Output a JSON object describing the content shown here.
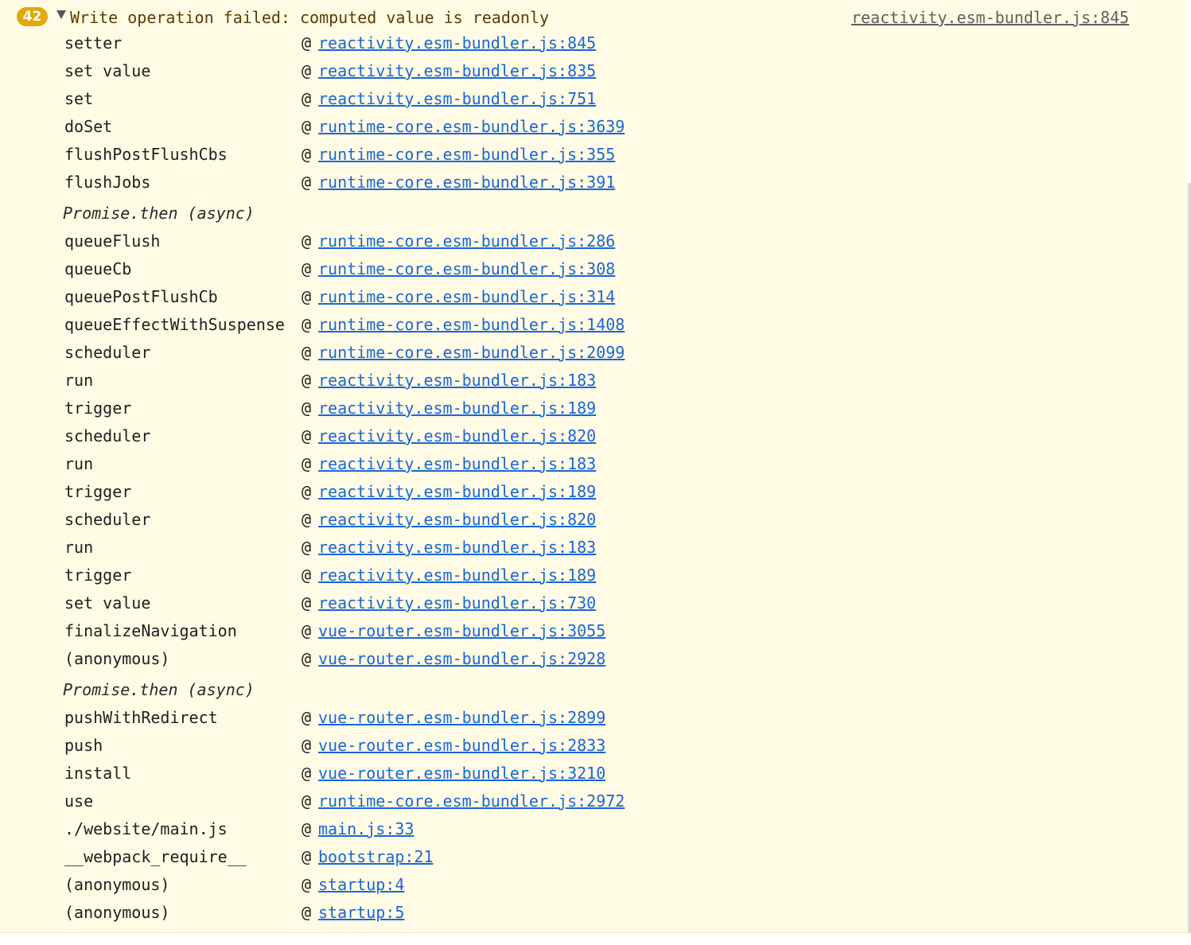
{
  "entry": {
    "count": "42",
    "message": "Write operation failed: computed value is readonly",
    "source": "reactivity.esm-bundler.js:845",
    "colors": {
      "badge": "#e3a90b",
      "background": "#fffbe5",
      "message": "#5c3c00",
      "link": "#1a66d8"
    }
  },
  "stack": [
    {
      "fn": "setter",
      "link": "reactivity.esm-bundler.js:845"
    },
    {
      "fn": "set value",
      "link": "reactivity.esm-bundler.js:835"
    },
    {
      "fn": "set",
      "link": "reactivity.esm-bundler.js:751"
    },
    {
      "fn": "doSet",
      "link": "runtime-core.esm-bundler.js:3639"
    },
    {
      "fn": "flushPostFlushCbs",
      "link": "runtime-core.esm-bundler.js:355"
    },
    {
      "fn": "flushJobs",
      "link": "runtime-core.esm-bundler.js:391"
    },
    {
      "async": "Promise.then (async)"
    },
    {
      "fn": "queueFlush",
      "link": "runtime-core.esm-bundler.js:286"
    },
    {
      "fn": "queueCb",
      "link": "runtime-core.esm-bundler.js:308"
    },
    {
      "fn": "queuePostFlushCb",
      "link": "runtime-core.esm-bundler.js:314"
    },
    {
      "fn": "queueEffectWithSuspense",
      "link": "runtime-core.esm-bundler.js:1408"
    },
    {
      "fn": "scheduler",
      "link": "runtime-core.esm-bundler.js:2099"
    },
    {
      "fn": "run",
      "link": "reactivity.esm-bundler.js:183"
    },
    {
      "fn": "trigger",
      "link": "reactivity.esm-bundler.js:189"
    },
    {
      "fn": "scheduler",
      "link": "reactivity.esm-bundler.js:820"
    },
    {
      "fn": "run",
      "link": "reactivity.esm-bundler.js:183"
    },
    {
      "fn": "trigger",
      "link": "reactivity.esm-bundler.js:189"
    },
    {
      "fn": "scheduler",
      "link": "reactivity.esm-bundler.js:820"
    },
    {
      "fn": "run",
      "link": "reactivity.esm-bundler.js:183"
    },
    {
      "fn": "trigger",
      "link": "reactivity.esm-bundler.js:189"
    },
    {
      "fn": "set value",
      "link": "reactivity.esm-bundler.js:730"
    },
    {
      "fn": "finalizeNavigation",
      "link": "vue-router.esm-bundler.js:3055"
    },
    {
      "fn": "(anonymous)",
      "link": "vue-router.esm-bundler.js:2928"
    },
    {
      "async": "Promise.then (async)"
    },
    {
      "fn": "pushWithRedirect",
      "link": "vue-router.esm-bundler.js:2899"
    },
    {
      "fn": "push",
      "link": "vue-router.esm-bundler.js:2833"
    },
    {
      "fn": "install",
      "link": "vue-router.esm-bundler.js:3210"
    },
    {
      "fn": "use",
      "link": "runtime-core.esm-bundler.js:2972"
    },
    {
      "fn": "./website/main.js",
      "link": "main.js:33"
    },
    {
      "fn": "__webpack_require__",
      "link": "bootstrap:21"
    },
    {
      "fn": "(anonymous)",
      "link": "startup:4"
    },
    {
      "fn": "(anonymous)",
      "link": "startup:5"
    }
  ]
}
